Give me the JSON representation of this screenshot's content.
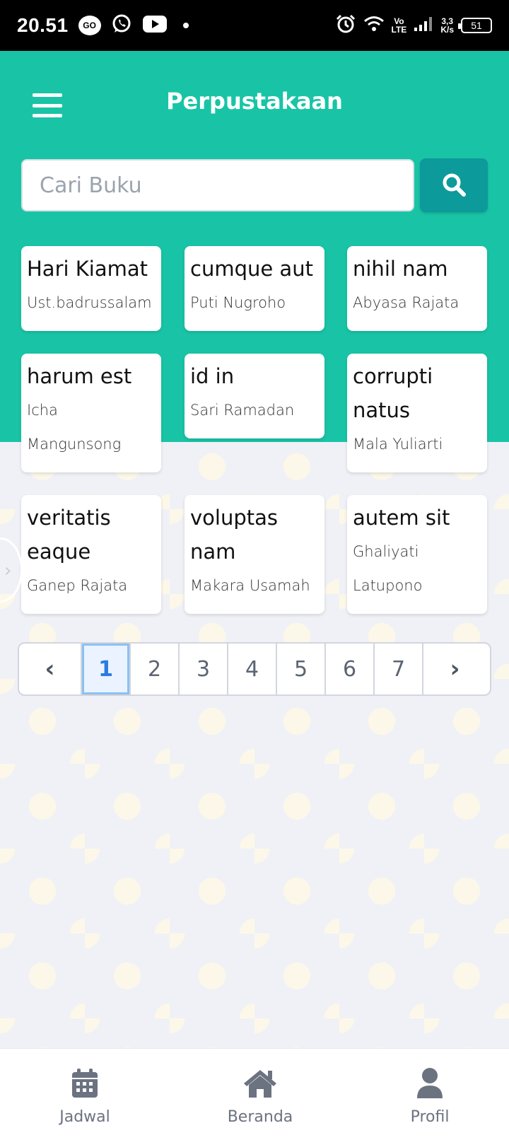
{
  "status_bar": {
    "time": "20.51",
    "go_label": "GO",
    "network_label_top": "Vo",
    "network_label_bottom": "LTE",
    "speed_top": "3,3",
    "speed_bottom": "K/s",
    "battery": "51"
  },
  "header": {
    "title": "Perpustakaan",
    "bg_color": "#19c4a6"
  },
  "search": {
    "placeholder": "Cari Buku",
    "value": "",
    "button_color": "#0d9a9b"
  },
  "books": [
    {
      "title": "Hari Kiamat",
      "author": "Ust.badrussalam"
    },
    {
      "title": "cumque aut",
      "author": "Puti Nugroho"
    },
    {
      "title": "nihil nam",
      "author": "Abyasa Rajata"
    },
    {
      "title": "harum est",
      "author": "Icha Mangunsong"
    },
    {
      "title": "id in",
      "author": "Sari Ramadan"
    },
    {
      "title": "corrupti natus",
      "author": "Mala Yuliarti"
    },
    {
      "title": "veritatis eaque",
      "author": "Ganep Rajata"
    },
    {
      "title": "voluptas nam",
      "author": "Makara Usamah"
    },
    {
      "title": "autem sit",
      "author": "Ghaliyati Latupono"
    }
  ],
  "pagination": {
    "prev": "‹",
    "next": "›",
    "pages": [
      "1",
      "2",
      "3",
      "4",
      "5",
      "6",
      "7"
    ],
    "current": "1"
  },
  "bottom_nav": {
    "items": [
      {
        "label": "Jadwal",
        "icon": "calendar-icon"
      },
      {
        "label": "Beranda",
        "icon": "home-icon"
      },
      {
        "label": "Profil",
        "icon": "user-icon"
      }
    ]
  }
}
